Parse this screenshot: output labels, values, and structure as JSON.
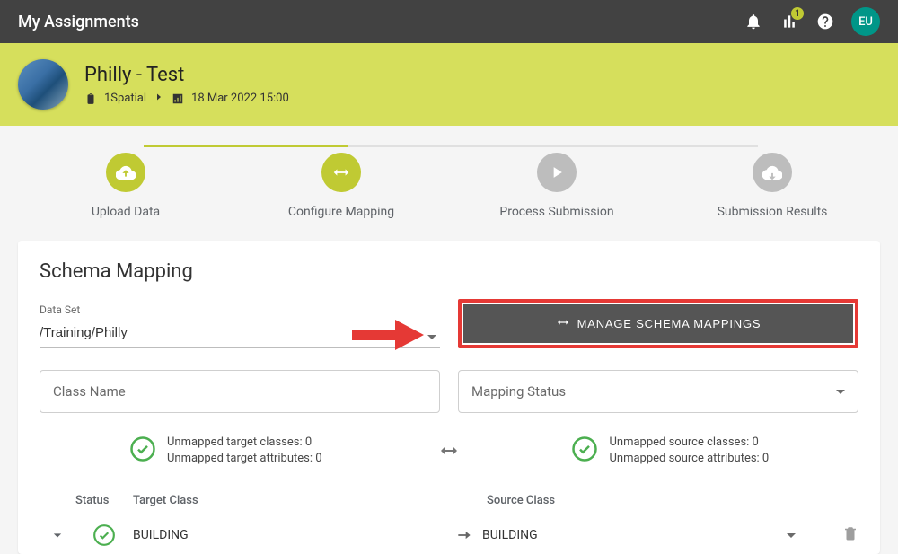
{
  "topbar": {
    "title": "My Assignments",
    "chart_badge": "1",
    "avatar": "EU"
  },
  "hero": {
    "title": "Philly - Test",
    "org": "1Spatial",
    "datetime": "18 Mar 2022 15:00"
  },
  "stepper": {
    "s1": "Upload Data",
    "s2": "Configure Mapping",
    "s3": "Process Submission",
    "s4": "Submission Results"
  },
  "card": {
    "heading": "Schema Mapping",
    "dataset_label": "Data Set",
    "dataset_value": "/Training/Philly",
    "manage_label": "MANAGE SCHEMA MAPPINGS",
    "classname_placeholder": "Class Name",
    "mapping_status_placeholder": "Mapping Status",
    "unmapped_target_classes": "Unmapped target classes: 0",
    "unmapped_target_attrs": "Unmapped target attributes: 0",
    "unmapped_source_classes": "Unmapped source classes: 0",
    "unmapped_source_attrs": "Unmapped source attributes: 0"
  },
  "table": {
    "status_header": "Status",
    "target_header": "Target Class",
    "source_header": "Source Class",
    "rows": [
      {
        "target": "BUILDING",
        "source": "BUILDING"
      }
    ]
  }
}
